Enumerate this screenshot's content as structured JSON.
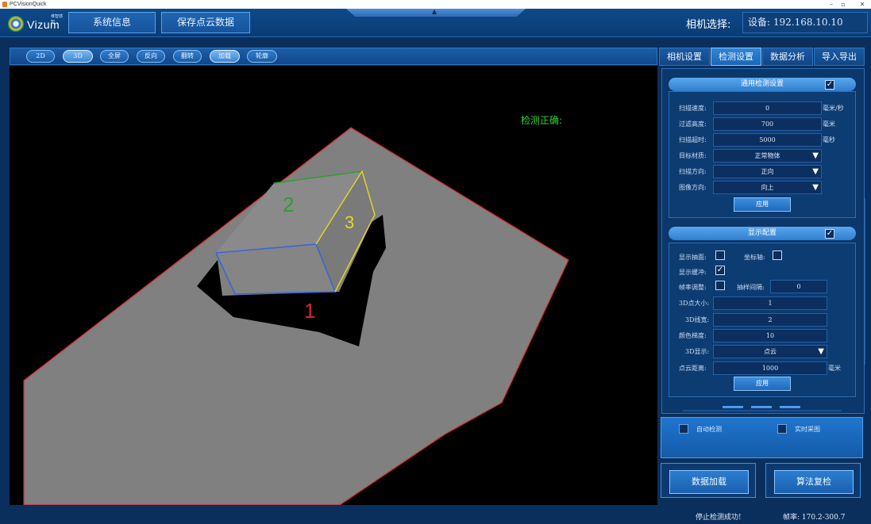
{
  "window": {
    "title": "PCVisionQuick",
    "minimize": "–",
    "maximize": "▫",
    "close": "✕"
  },
  "header": {
    "logo_name": "Vizum",
    "logo_sub": "维智感知",
    "buttons": [
      "系统信息",
      "保存点云数据"
    ],
    "notch_arrow": "▲",
    "camera_label": "相机选择:",
    "camera_value": "设备: 192.168.10.10"
  },
  "toolbar": {
    "buttons": [
      {
        "label": "2D",
        "active": false
      },
      {
        "label": "3D",
        "active": true
      },
      {
        "label": "全屏",
        "active": false
      },
      {
        "label": "反向",
        "active": false
      },
      {
        "label": "翻转",
        "active": false
      },
      {
        "label": "加载",
        "active": true
      },
      {
        "label": "轮廓",
        "active": false
      }
    ]
  },
  "viewport": {
    "status_text": "检测正确:",
    "labels": [
      "1",
      "2",
      "3"
    ],
    "colors": {
      "surface": "#808080",
      "edge1": "#3a66d8",
      "edge2": "#2f9e2f",
      "edge3": "#e6d81c",
      "label1": "#d8232f",
      "label2": "#2f9e2f",
      "label3": "#e6d81c",
      "outline": "#d8232f"
    }
  },
  "tabs": [
    {
      "label": "相机设置",
      "active": false
    },
    {
      "label": "检测设置",
      "active": true
    },
    {
      "label": "数据分析",
      "active": false
    },
    {
      "label": "导入导出",
      "active": false
    }
  ],
  "detection": {
    "title": "通用检测设置",
    "enabled": true,
    "fields": [
      {
        "label": "扫描速度:",
        "value": "0",
        "unit": "毫米/秒"
      },
      {
        "label": "过滤高度:",
        "value": "700",
        "unit": "毫米"
      },
      {
        "label": "扫描超时:",
        "value": "5000",
        "unit": "毫秒"
      }
    ],
    "selects": [
      {
        "label": "目标材质:",
        "value": "正常物体"
      },
      {
        "label": "扫描方向:",
        "value": "正向"
      },
      {
        "label": "图像方向:",
        "value": "向上"
      }
    ],
    "apply": "应用"
  },
  "display": {
    "title": "显示配置",
    "enabled": true,
    "show_surface_label": "显示抽面:",
    "show_surface": false,
    "axis_label": "坐标轴:",
    "axis": false,
    "buffer_label": "显示缓冲:",
    "buffer": true,
    "fps_label": "帧率调整:",
    "fps": false,
    "sample_label": "抽样间隔:",
    "sample_value": "0",
    "fields": [
      {
        "label": "3D点大小:",
        "value": "1"
      },
      {
        "label": "3D线宽:",
        "value": "2"
      },
      {
        "label": "颜色梯度:",
        "value": "10"
      }
    ],
    "mode_label": "3D显示:",
    "mode_value": "点云",
    "distance_label": "点云距离:",
    "distance_value": "1000",
    "distance_unit": "毫米",
    "apply": "应用"
  },
  "modes": {
    "auto_detect": "自动检测",
    "realtime": "实时采图"
  },
  "actions": {
    "load": "数据加载",
    "recheck": "算法复检"
  },
  "status": {
    "message": "停止检测成功!",
    "fps": "帧率: 170.2-300.7"
  }
}
